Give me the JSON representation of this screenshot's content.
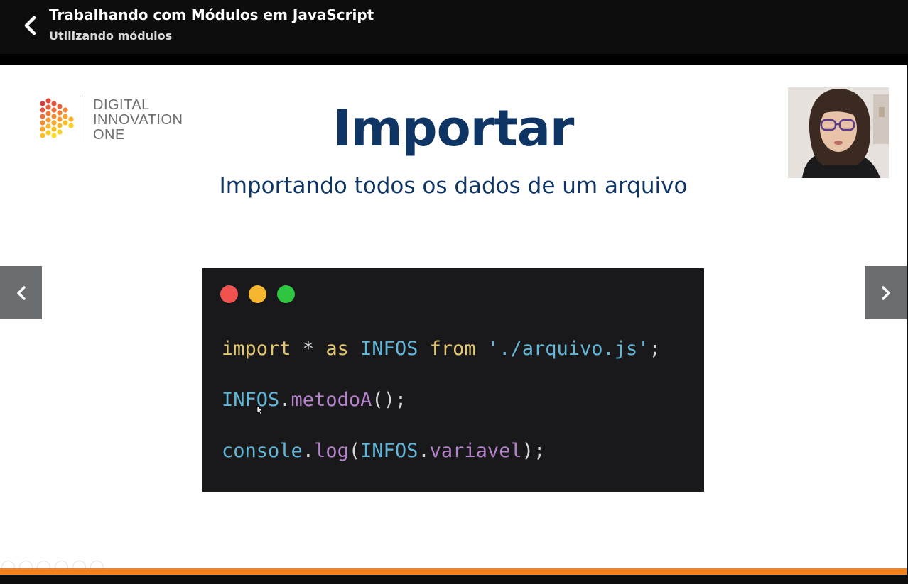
{
  "header": {
    "course_title": "Trabalhando com Módulos em JavaScript",
    "lesson_title": "Utilizando módulos",
    "back_icon": "chevron-left-icon"
  },
  "slide": {
    "logo": {
      "line1": "DIGITAL",
      "line2": "INNOVATION",
      "line3": "ONE"
    },
    "title": "Importar",
    "subtitle": "Importando todos os dados de um arquivo",
    "code": {
      "line1": {
        "kw_import": "import",
        "star": " * ",
        "kw_as": "as",
        "ident": " INFOS ",
        "kw_from": "from",
        "string": " './arquivo.js'",
        "semi": ";"
      },
      "line2": {
        "obj": "INFOS",
        "dot": ".",
        "method": "metodoA",
        "rest": "();"
      },
      "line3": {
        "obj": "console",
        "dot1": ".",
        "method": "log",
        "paren": "(",
        "arg_obj": "INFOS",
        "dot2": ".",
        "prop": "variavel",
        "close": ");"
      }
    }
  },
  "nav": {
    "prev_icon": "chevron-left-icon",
    "next_icon": "chevron-right-icon"
  },
  "progress": {
    "percent": 100
  },
  "colors": {
    "title_navy": "#0f3564",
    "progress_orange": "#f6821f",
    "code_bg": "#19191b",
    "code_yellow": "#e3c770",
    "code_blue": "#62b7d8",
    "code_purple": "#b583c9"
  }
}
